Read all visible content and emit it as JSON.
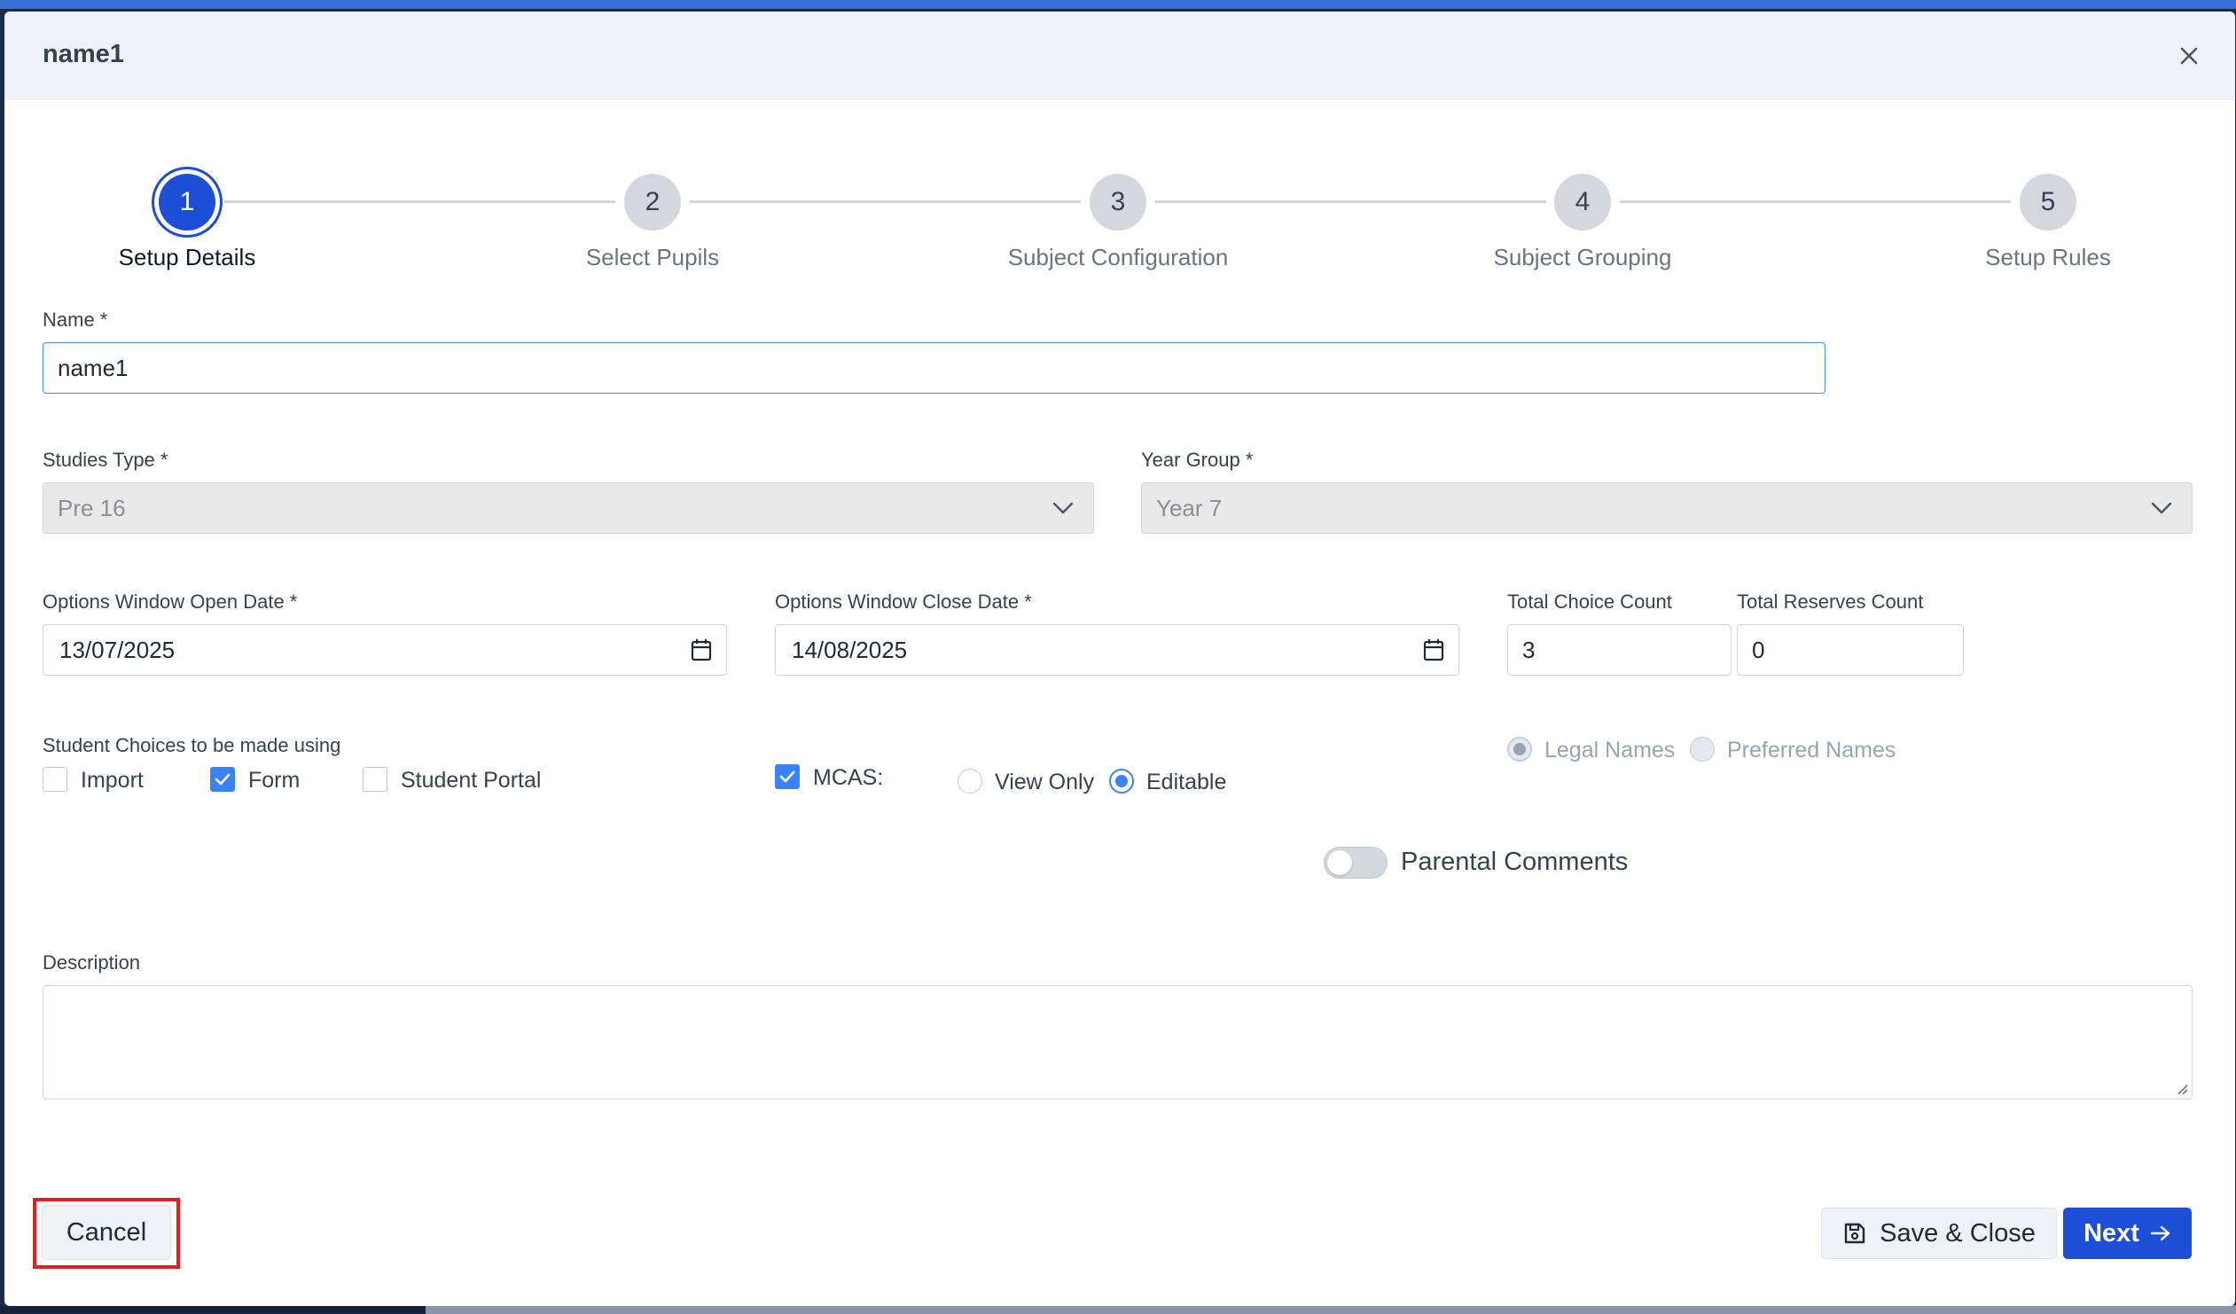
{
  "modal": {
    "title": "name1"
  },
  "stepper": [
    {
      "number": "1",
      "label": "Setup Details"
    },
    {
      "number": "2",
      "label": "Select Pupils"
    },
    {
      "number": "3",
      "label": "Subject Configuration"
    },
    {
      "number": "4",
      "label": "Subject Grouping"
    },
    {
      "number": "5",
      "label": "Setup Rules"
    }
  ],
  "form": {
    "name_label": "Name *",
    "name_value": "name1",
    "studies_type_label": "Studies Type *",
    "studies_type_value": "Pre 16",
    "year_group_label": "Year Group *",
    "year_group_value": "Year 7",
    "open_date_label": "Options Window Open Date *",
    "open_date_value": "13/07/2025",
    "close_date_label": "Options Window Close Date *",
    "close_date_value": "14/08/2025",
    "total_choice_label": "Total Choice Count",
    "total_choice_value": "3",
    "total_reserves_label": "Total Reserves Count",
    "total_reserves_value": "0",
    "choices_made_using_label": "Student Choices to be made using",
    "import_label": "Import",
    "form_label": "Form",
    "student_portal_label": "Student Portal",
    "mcas_label": "MCAS:",
    "view_only_label": "View Only",
    "editable_label": "Editable",
    "legal_names_label": "Legal Names",
    "preferred_names_label": "Preferred Names",
    "parental_comments_label": "Parental Comments",
    "description_label": "Description",
    "description_value": ""
  },
  "footer": {
    "cancel_label": "Cancel",
    "save_close_label": "Save & Close",
    "next_label": "Next"
  },
  "colors": {
    "primary": "#1d4ed8",
    "checkbox": "#3b82f6",
    "highlight": "#e02020"
  },
  "icons": [
    "close-icon",
    "chevron-down-icon",
    "calendar-icon",
    "check-icon",
    "save-icon",
    "arrow-right-icon"
  ]
}
